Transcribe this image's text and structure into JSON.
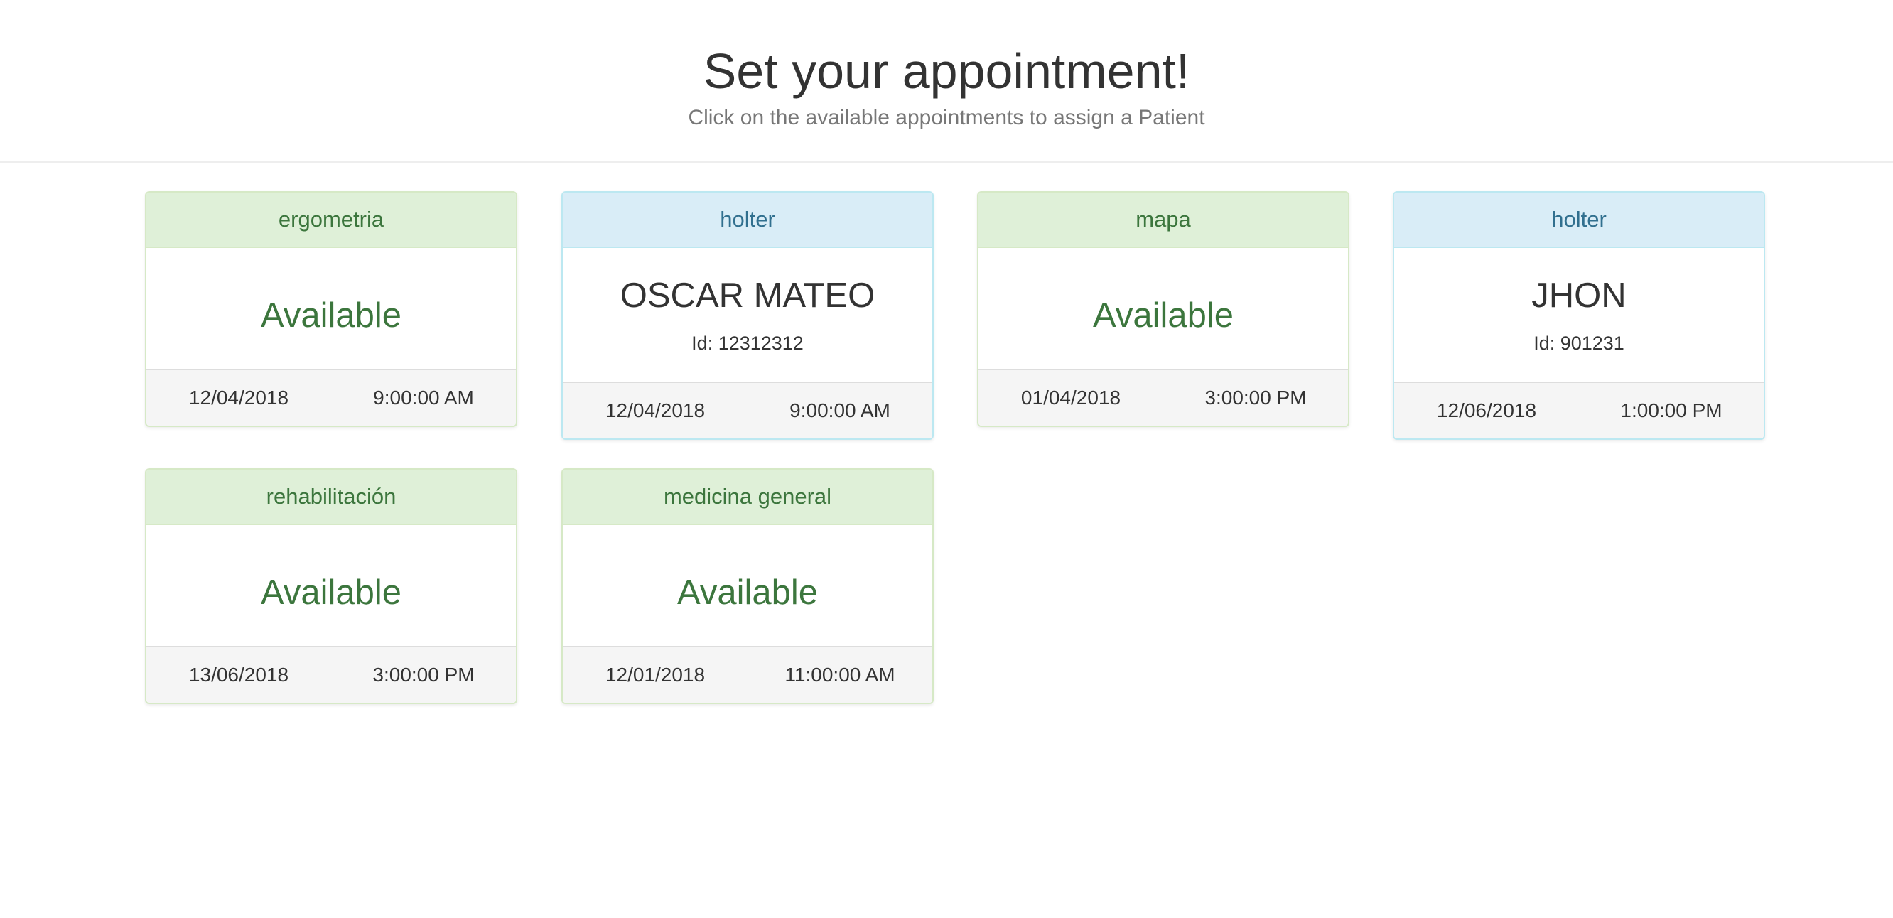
{
  "header": {
    "title": "Set your appointment!",
    "subtitle": "Click on the available appointments to assign a Patient"
  },
  "appointments": [
    {
      "study": "ergometria",
      "status": "Available",
      "date": "12/04/2018",
      "time": "9:00:00 AM",
      "variant": "success"
    },
    {
      "study": "holter",
      "patient_name": "OSCAR MATEO",
      "patient_id": "Id: 12312312",
      "date": "12/04/2018",
      "time": "9:00:00 AM",
      "variant": "info"
    },
    {
      "study": "mapa",
      "status": "Available",
      "date": "01/04/2018",
      "time": "3:00:00 PM",
      "variant": "success"
    },
    {
      "study": "holter",
      "patient_name": "JHON",
      "patient_id": "Id: 901231",
      "date": "12/06/2018",
      "time": "1:00:00 PM",
      "variant": "info"
    },
    {
      "study": "rehabilitación",
      "status": "Available",
      "date": "13/06/2018",
      "time": "3:00:00 PM",
      "variant": "success"
    },
    {
      "study": "medicina general",
      "status": "Available",
      "date": "12/01/2018",
      "time": "11:00:00 AM",
      "variant": "success"
    }
  ],
  "colors": {
    "success_bg": "#dff0d8",
    "success_text": "#3c763d",
    "info_bg": "#d9edf7",
    "info_text": "#31708f"
  }
}
